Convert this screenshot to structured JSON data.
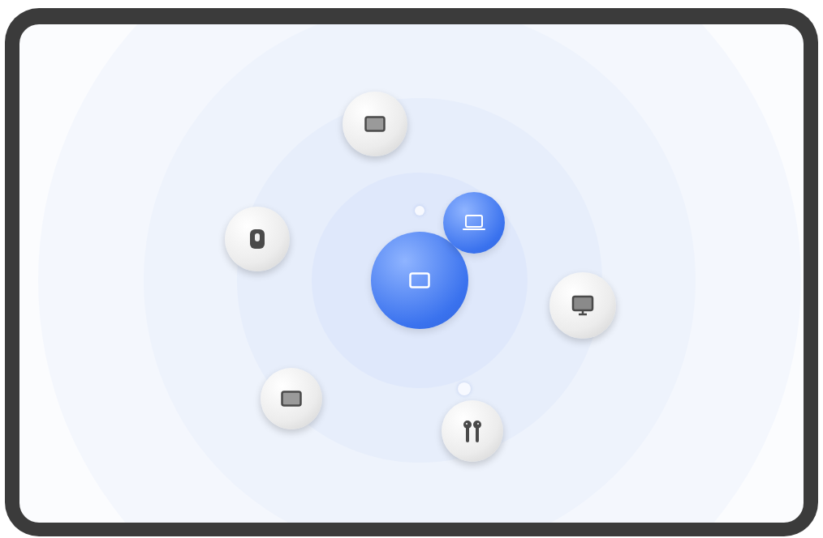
{
  "center_device": {
    "kind": "tablet"
  },
  "devices": [
    {
      "kind": "tablet",
      "connected": false
    },
    {
      "kind": "speaker",
      "connected": false
    },
    {
      "kind": "laptop",
      "connected": true
    },
    {
      "kind": "monitor",
      "connected": false
    },
    {
      "kind": "tablet",
      "connected": false
    },
    {
      "kind": "earbuds",
      "connected": false
    }
  ]
}
